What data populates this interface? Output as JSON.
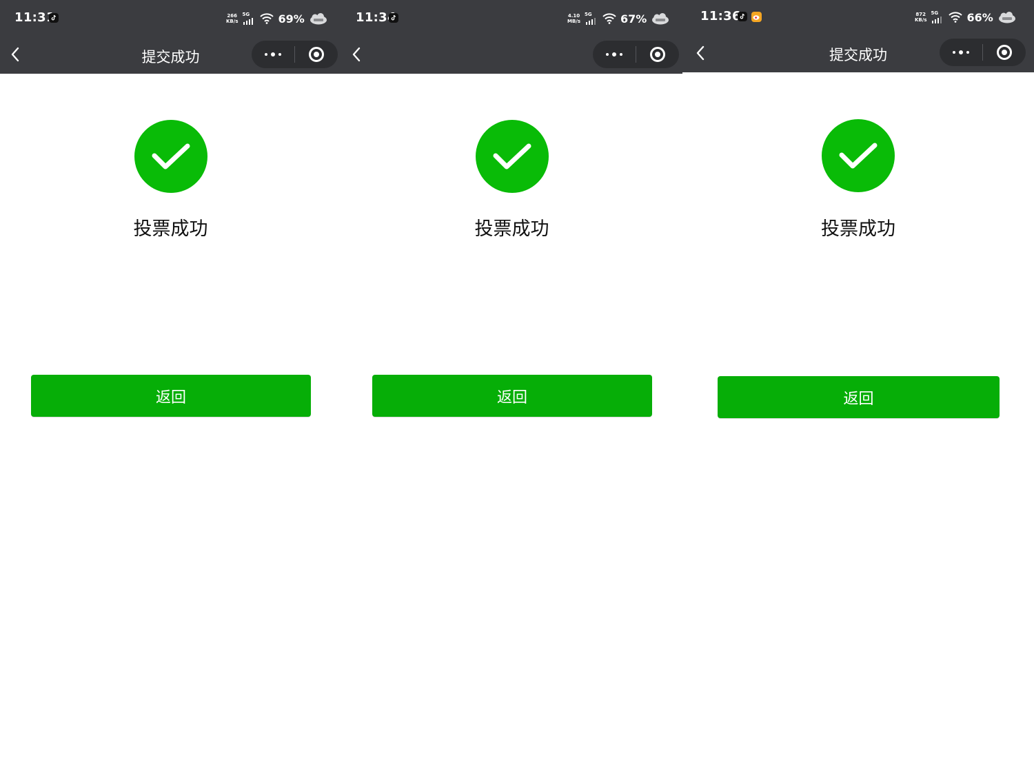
{
  "theme": {
    "topbar_color": "#3b3c40",
    "success_green": "#09bb07",
    "button_green": "#06ae07"
  },
  "screens": [
    {
      "status": {
        "time": "11:31",
        "net_speed_value": "266",
        "net_speed_unit": "KB/s",
        "network": "5G",
        "battery": "69%",
        "app_icons": [
          "tiktok-icon"
        ]
      },
      "nav": {
        "title": "提交成功"
      },
      "content": {
        "message": "投票成功",
        "button_label": "返回"
      }
    },
    {
      "status": {
        "time": "11:34",
        "net_speed_value": "4.10",
        "net_speed_unit": "MB/s",
        "network": "5G",
        "battery": "67%",
        "app_icons": [
          "tiktok-icon"
        ]
      },
      "nav": {
        "title": ""
      },
      "content": {
        "message": "投票成功",
        "button_label": "返回"
      }
    },
    {
      "status": {
        "time": "11:36",
        "net_speed_value": "872",
        "net_speed_unit": "KB/s",
        "network": "5G",
        "battery": "66%",
        "app_icons": [
          "tiktok-icon",
          "weibo-icon"
        ]
      },
      "nav": {
        "title": "提交成功"
      },
      "content": {
        "message": "投票成功",
        "button_label": "返回"
      }
    }
  ]
}
